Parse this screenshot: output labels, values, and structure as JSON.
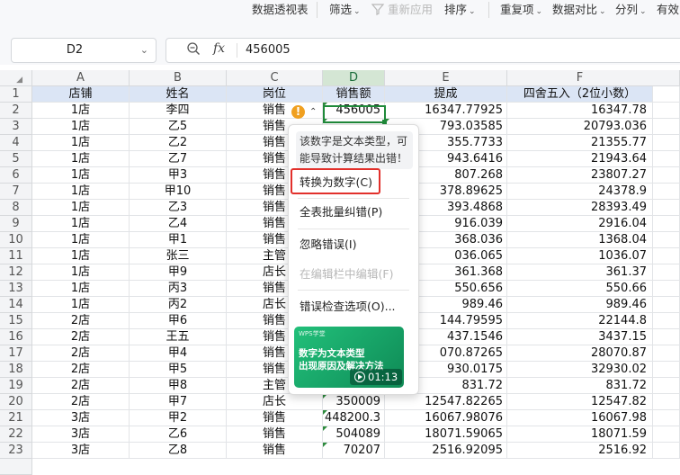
{
  "ribbon": {
    "items": [
      {
        "label": "数据透视表",
        "dropdown": false,
        "disabled": false
      },
      {
        "label": "筛选",
        "dropdown": true,
        "disabled": false
      },
      {
        "label": "重新应用",
        "dropdown": false,
        "disabled": true
      },
      {
        "label": "排序",
        "dropdown": true,
        "disabled": false
      },
      {
        "label": "重复项",
        "dropdown": true,
        "disabled": false
      },
      {
        "label": "数据对比",
        "dropdown": true,
        "disabled": false
      },
      {
        "label": "分列",
        "dropdown": true,
        "disabled": false
      },
      {
        "label": "有效",
        "dropdown": false,
        "disabled": false
      }
    ]
  },
  "formula_bar": {
    "cell_ref": "D2",
    "fx_label": "fx",
    "value": "456005"
  },
  "columns": [
    "A",
    "B",
    "C",
    "D",
    "E",
    "F"
  ],
  "selected_column": "D",
  "header_row": [
    "店铺",
    "姓名",
    "岗位",
    "销售额",
    "提成",
    "四舍五入（2位小数）"
  ],
  "rows": [
    {
      "n": "2",
      "a": "1店",
      "b": "李四",
      "c": "销售",
      "d": "456005",
      "e": "16347.77925",
      "f": "16347.78"
    },
    {
      "n": "3",
      "a": "1店",
      "b": "乙5",
      "c": "销售",
      "d": "",
      "e": "793.03585",
      "f": "20793.036"
    },
    {
      "n": "4",
      "a": "1店",
      "b": "乙2",
      "c": "销售",
      "d": "",
      "e": "355.7733",
      "f": "21355.77"
    },
    {
      "n": "5",
      "a": "1店",
      "b": "乙7",
      "c": "销售",
      "d": "",
      "e": "943.6416",
      "f": "21943.64"
    },
    {
      "n": "6",
      "a": "1店",
      "b": "甲3",
      "c": "销售",
      "d": "",
      "e": "807.268",
      "f": "23807.27"
    },
    {
      "n": "7",
      "a": "1店",
      "b": "甲10",
      "c": "销售",
      "d": "",
      "e": "378.89625",
      "f": "24378.9"
    },
    {
      "n": "8",
      "a": "1店",
      "b": "乙3",
      "c": "销售",
      "d": "",
      "e": "393.4868",
      "f": "28393.49"
    },
    {
      "n": "9",
      "a": "1店",
      "b": "乙4",
      "c": "销售",
      "d": "",
      "e": "916.039",
      "f": "2916.04"
    },
    {
      "n": "10",
      "a": "1店",
      "b": "甲1",
      "c": "销售",
      "d": "",
      "e": "368.036",
      "f": "1368.04"
    },
    {
      "n": "11",
      "a": "1店",
      "b": "张三",
      "c": "主管",
      "d": "",
      "e": "036.065",
      "f": "1036.07"
    },
    {
      "n": "12",
      "a": "1店",
      "b": "甲9",
      "c": "店长",
      "d": "",
      "e": "361.368",
      "f": "361.37"
    },
    {
      "n": "13",
      "a": "1店",
      "b": "丙3",
      "c": "销售",
      "d": "",
      "e": "550.656",
      "f": "550.66"
    },
    {
      "n": "14",
      "a": "1店",
      "b": "丙2",
      "c": "店长",
      "d": "",
      "e": "989.46",
      "f": "989.46"
    },
    {
      "n": "15",
      "a": "2店",
      "b": "甲6",
      "c": "销售",
      "d": "",
      "e": "144.79595",
      "f": "22144.8"
    },
    {
      "n": "16",
      "a": "2店",
      "b": "王五",
      "c": "销售",
      "d": "",
      "e": "437.1546",
      "f": "3437.15"
    },
    {
      "n": "17",
      "a": "2店",
      "b": "甲4",
      "c": "销售",
      "d": "",
      "e": "070.87265",
      "f": "28070.87"
    },
    {
      "n": "18",
      "a": "2店",
      "b": "甲5",
      "c": "销售",
      "d": "",
      "e": "930.0175",
      "f": "32930.02"
    },
    {
      "n": "19",
      "a": "2店",
      "b": "甲8",
      "c": "主管",
      "d": "",
      "e": "831.72",
      "f": "831.72"
    },
    {
      "n": "20",
      "a": "2店",
      "b": "甲7",
      "c": "店长",
      "d": "350009",
      "e": "12547.82265",
      "f": "12547.82"
    },
    {
      "n": "21",
      "a": "3店",
      "b": "甲2",
      "c": "销售",
      "d": "448200.3",
      "e": "16067.98076",
      "f": "16067.98"
    },
    {
      "n": "22",
      "a": "3店",
      "b": "乙6",
      "c": "销售",
      "d": "504089",
      "e": "18071.59065",
      "f": "18071.59"
    },
    {
      "n": "23",
      "a": "3店",
      "b": "乙8",
      "c": "销售",
      "d": "70207",
      "e": "2516.92095",
      "f": "2516.92"
    }
  ],
  "error_popup": {
    "hint": "该数字是文本类型，可能导致计算结果出错！",
    "menu": [
      {
        "label": "转换为数字(C)",
        "highlighted": true,
        "disabled": false
      },
      {
        "label": "全表批量纠错(P)",
        "highlighted": false,
        "disabled": false
      },
      {
        "label": "忽略错误(I)",
        "highlighted": false,
        "disabled": false
      },
      {
        "label": "在编辑栏中编辑(F)",
        "highlighted": false,
        "disabled": true
      },
      {
        "label": "错误检查选项(O)...",
        "highlighted": false,
        "disabled": false
      }
    ],
    "video": {
      "brand": "WPS学堂",
      "title_line1": "数字为文本类型",
      "title_line2": "出现原因及解决方法",
      "duration": "01:13"
    }
  },
  "colors": {
    "accent_green": "#1f8a3a",
    "header_fill": "#dbe5f5",
    "highlight_red": "#e2302b",
    "warning": "#f0a020"
  }
}
